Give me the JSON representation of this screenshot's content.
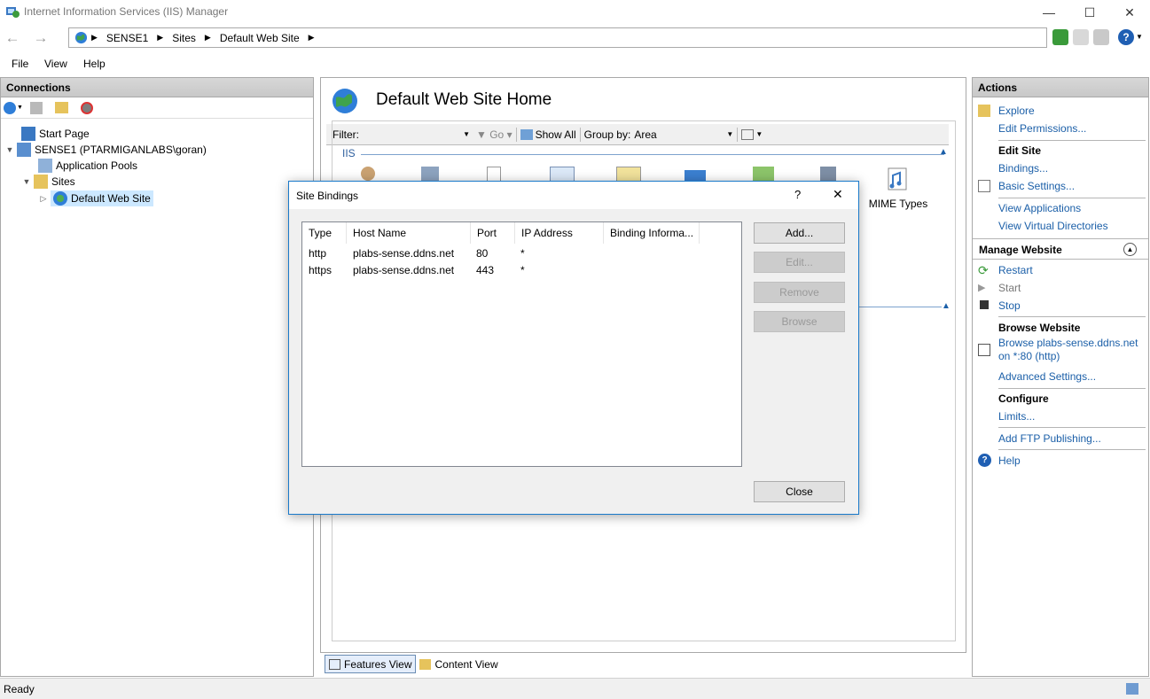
{
  "window": {
    "title": "Internet Information Services (IIS) Manager",
    "minimize": "—",
    "maximize": "☐",
    "close": "✕"
  },
  "address": {
    "crumbs": [
      "SENSE1",
      "Sites",
      "Default Web Site"
    ],
    "back_icon": "←",
    "forward_icon": "→",
    "help_label": "?"
  },
  "menu": {
    "file": "File",
    "view": "View",
    "help": "Help"
  },
  "connections": {
    "header": "Connections",
    "tree": [
      {
        "label": "Start Page"
      },
      {
        "label": "SENSE1 (PTARMIGANLABS\\goran)"
      },
      {
        "label": "Application Pools"
      },
      {
        "label": "Sites"
      },
      {
        "label": "Default Web Site"
      }
    ]
  },
  "center": {
    "title": "Default Web Site Home",
    "filter_label": "Filter:",
    "go_label": "Go",
    "show_all_label": "Show All",
    "group_by_label": "Group by:",
    "group_by_value": "Area",
    "section_iis": "IIS",
    "mime_types_label": "MIME Types"
  },
  "viewtabs": {
    "features": "Features View",
    "content": "Content View"
  },
  "actions": {
    "header": "Actions",
    "explore": "Explore",
    "edit_permissions": "Edit Permissions...",
    "edit_site": "Edit Site",
    "bindings": "Bindings...",
    "basic_settings": "Basic Settings...",
    "view_applications": "View Applications",
    "view_virtual_directories": "View Virtual Directories",
    "manage_website": "Manage Website",
    "restart": "Restart",
    "start": "Start",
    "stop": "Stop",
    "browse_website": "Browse Website",
    "browse_link_line1": "Browse plabs-sense.ddns.net",
    "browse_link_line2": "on *:80 (http)",
    "advanced_settings": "Advanced Settings...",
    "configure": "Configure",
    "limits": "Limits...",
    "add_ftp": "Add FTP Publishing...",
    "help": "Help"
  },
  "status": {
    "text": "Ready"
  },
  "dialog": {
    "title": "Site Bindings",
    "help_glyph": "?",
    "close_glyph": "✕",
    "columns": [
      "Type",
      "Host Name",
      "Port",
      "IP Address",
      "Binding Informa..."
    ],
    "rows": [
      {
        "type": "http",
        "host": "plabs-sense.ddns.net",
        "port": "80",
        "ip": "*",
        "info": ""
      },
      {
        "type": "https",
        "host": "plabs-sense.ddns.net",
        "port": "443",
        "ip": "*",
        "info": ""
      }
    ],
    "buttons": {
      "add": "Add...",
      "edit": "Edit...",
      "remove": "Remove",
      "browse": "Browse",
      "close": "Close"
    }
  },
  "colors": {
    "link": "#1b5fa8",
    "dialog_border": "#1979ca",
    "selected_item": "#cce8ff"
  }
}
